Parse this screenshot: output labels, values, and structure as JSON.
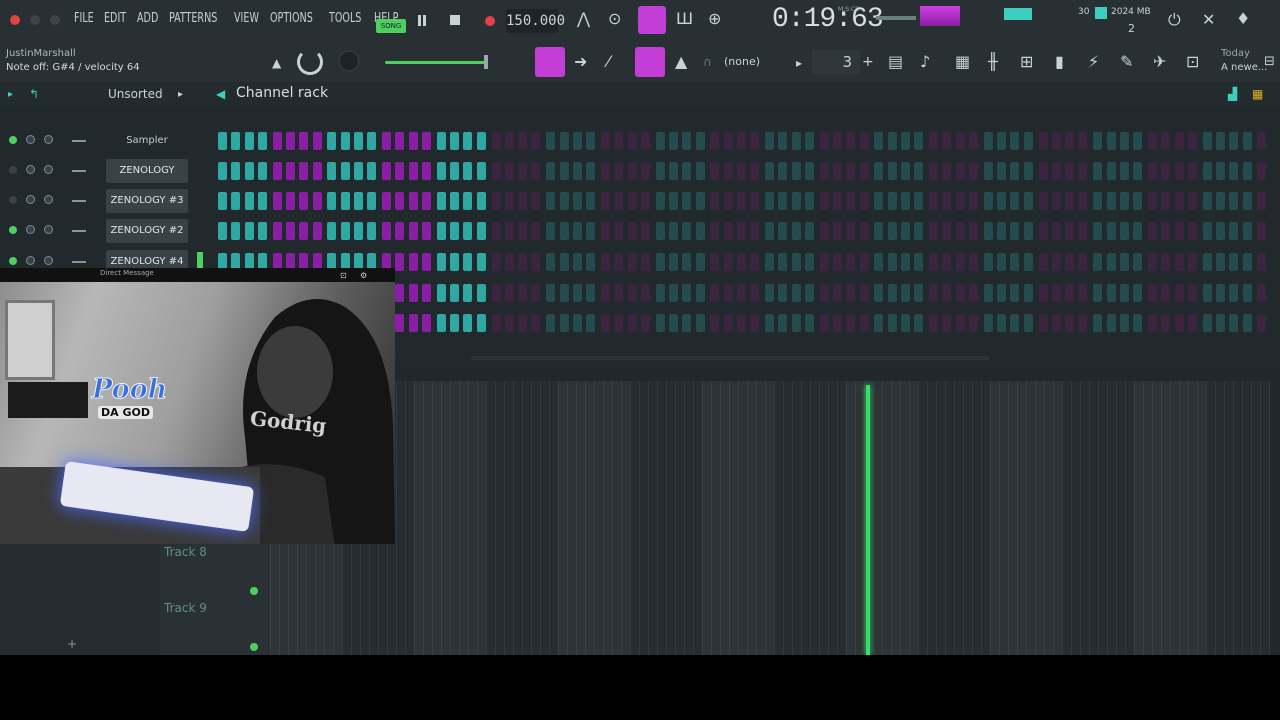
{
  "menu": [
    "FILE",
    "EDIT",
    "ADD",
    "PATTERNS",
    "VIEW",
    "OPTIONS",
    "TOOLS",
    "HELP"
  ],
  "transport": {
    "mode_label": "SONG",
    "tempo": "150.000",
    "time": "0:19:63",
    "time_unit": "M:S:CS",
    "cpu": "30",
    "ram": "2024 MB",
    "voices": "2"
  },
  "hint_panel": {
    "user": "JustinMarshall",
    "hint": "Note off: G#4 / velocity 64"
  },
  "pattern_selector": {
    "name": "(none)",
    "number": "3"
  },
  "news": {
    "date": "Today",
    "text": "A newe..."
  },
  "channel_rack": {
    "title": "Channel rack",
    "filter": "Unsorted",
    "channels": [
      {
        "name": "Sampler",
        "led": "on"
      },
      {
        "name": "ZENOLOGY",
        "led": "off"
      },
      {
        "name": "ZENOLOGY #3",
        "led": "off"
      },
      {
        "name": "ZENOLOGY #2",
        "led": "on"
      },
      {
        "name": "ZENOLOGY #4",
        "led": "on"
      }
    ]
  },
  "playlist": {
    "tracks": [
      "Track 8",
      "Track 9"
    ]
  },
  "webcam": {
    "title": "Direct Message",
    "logo": "Pooh",
    "logo_sub": "DA GOD",
    "shirt_text": "Godrig"
  },
  "colors": {
    "accent": "#c33ed6",
    "teal_step": "#2fa8a4",
    "teal_step_dim": "#244b4d",
    "purple_step": "#8a1fa6",
    "purple_step_dim": "#3a2440",
    "playhead": "#33e06a"
  }
}
